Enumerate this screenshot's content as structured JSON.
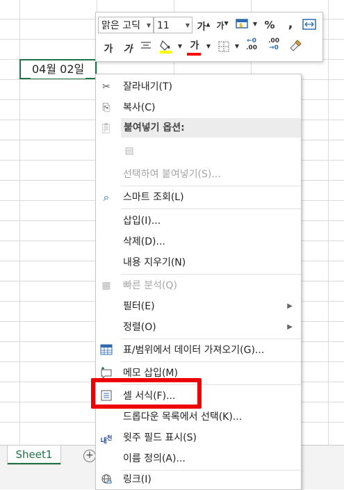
{
  "cell": {
    "value": "04월 02일"
  },
  "sheet": {
    "tab_label": "Sheet1",
    "add_label": "+"
  },
  "mini_toolbar": {
    "font_name": "맑은 고딕",
    "font_size": "11",
    "increase_font": "가",
    "decrease_font": "가",
    "percent": "%",
    "comma": ",",
    "bold": "가",
    "italic": "가",
    "font_color_letter": "가",
    "increase_decimal": ".00",
    "decrease_decimal": ".00",
    "fill_color": "#ffff00",
    "font_color": "#ff0000"
  },
  "menu": {
    "cut": "잘라내기(T)",
    "copy": "복사(C)",
    "paste_options": "붙여넣기 옵션:",
    "paste_special": "선택하여 붙여넣기(S)...",
    "smart_lookup": "스마트 조회(L)",
    "insert": "삽입(I)...",
    "delete": "삭제(D)...",
    "clear_contents": "내용 지우기(N)",
    "quick_analysis": "빠른 분석(Q)",
    "filter": "필터(E)",
    "sort": "정렬(O)",
    "get_data": "표/범위에서 데이터 가져오기(G)...",
    "insert_comment": "메모 삽입(M)",
    "format_cells": "셀 서식(F)...",
    "pick_from_list": "드롭다운 목록에서 선택(K)...",
    "phonetic": "윗주 필드 표시(S)",
    "define_name": "이름 정의(A)...",
    "link": "링크(I)"
  },
  "highlight_color": "#ee0000"
}
